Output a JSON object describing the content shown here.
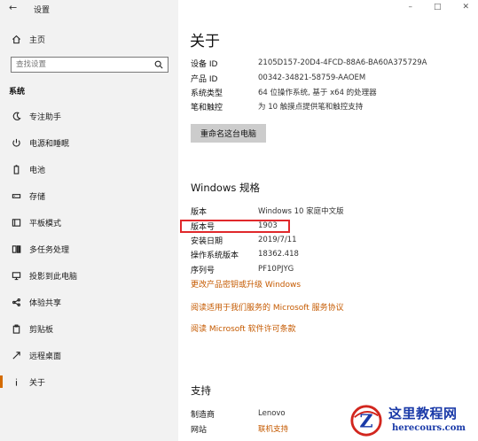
{
  "window": {
    "title": "设置",
    "minimize": "–",
    "maximize": "□",
    "close": "✕"
  },
  "sidebar": {
    "home": "主页",
    "search_placeholder": "查找设置",
    "section": "系统",
    "items": [
      {
        "label": "专注助手",
        "icon": "moon-icon"
      },
      {
        "label": "电源和睡眠",
        "icon": "power-icon"
      },
      {
        "label": "电池",
        "icon": "battery-icon"
      },
      {
        "label": "存储",
        "icon": "storage-icon"
      },
      {
        "label": "平板模式",
        "icon": "tablet-icon"
      },
      {
        "label": "多任务处理",
        "icon": "multitask-icon"
      },
      {
        "label": "投影到此电脑",
        "icon": "project-icon"
      },
      {
        "label": "体验共享",
        "icon": "share-icon"
      },
      {
        "label": "剪贴板",
        "icon": "clipboard-icon"
      },
      {
        "label": "远程桌面",
        "icon": "remote-icon"
      },
      {
        "label": "关于",
        "icon": "info-icon",
        "active": true
      }
    ],
    "accent": "#d46b00"
  },
  "main": {
    "title": "关于",
    "device_specs": [
      {
        "label": "设备 ID",
        "value": "2105D157-20D4-4FCD-88A6-BA60A375729A"
      },
      {
        "label": "产品 ID",
        "value": "00342-34821-58759-AAOEM"
      },
      {
        "label": "系统类型",
        "value": "64 位操作系统, 基于 x64 的处理器"
      },
      {
        "label": "笔和触控",
        "value": "为 10 触摸点提供笔和触控支持"
      }
    ],
    "rename_button": "重命名这台电脑",
    "windows_specs": {
      "heading": "Windows 规格",
      "rows": [
        {
          "label": "版本",
          "value": "Windows 10 家庭中文版"
        },
        {
          "label": "版本号",
          "value": "1903"
        },
        {
          "label": "安装日期",
          "value": "2019/7/11"
        },
        {
          "label": "操作系统版本",
          "value": "18362.418"
        },
        {
          "label": "序列号",
          "value": "PF10PJYG"
        }
      ],
      "links": [
        "更改产品密钥或升级 Windows",
        "阅读适用于我们服务的 Microsoft 服务协议",
        "阅读 Microsoft 软件许可条款"
      ]
    },
    "support": {
      "heading": "支持",
      "rows": [
        {
          "label": "制造商",
          "value": "Lenovo"
        },
        {
          "label": "网站",
          "value": "联机支持"
        }
      ]
    },
    "link_color": "#c55a00",
    "highlight_color": "#e0282b"
  },
  "watermark": {
    "title": "这里教程网",
    "url": "herecours.com"
  }
}
